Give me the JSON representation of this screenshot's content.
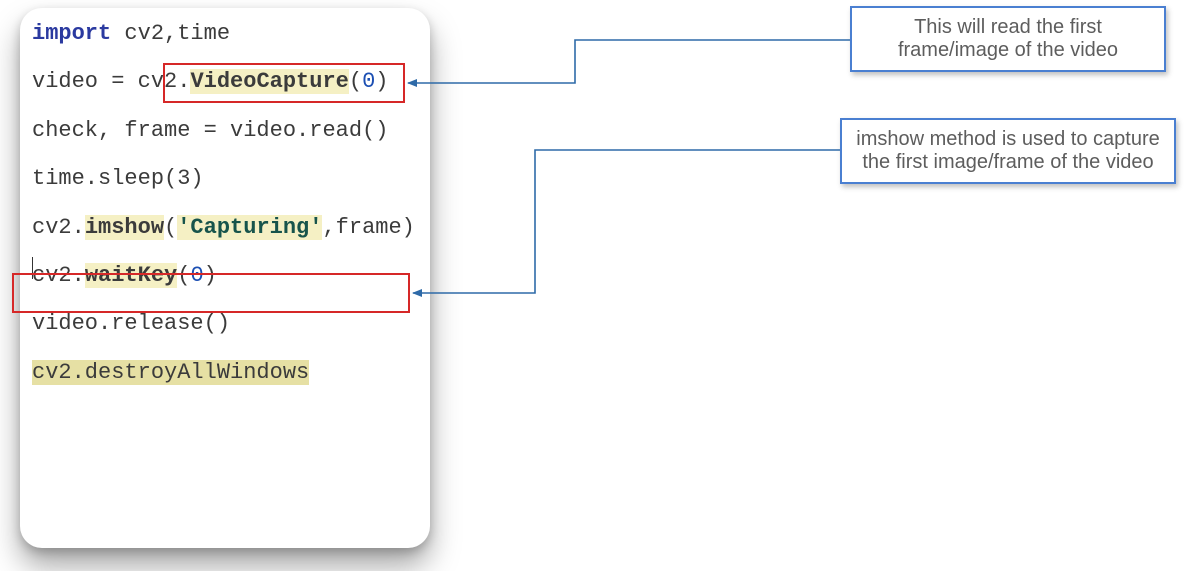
{
  "code": {
    "line1_import": "import",
    "line1_rest": " cv2,time",
    "blank": "",
    "line3_a": "video = cv2.",
    "line3_fn": "VideoCapture",
    "line3_paren_o": "(",
    "line3_num": "0",
    "line3_paren_c": ")",
    "line5": "check, frame = video.read()",
    "line7": "time.sleep(3)",
    "line9_a": "cv2.",
    "line9_fn": "imshow",
    "line9_paren_o": "(",
    "line9_str": "'Capturing'",
    "line9_rest": ",frame)",
    "line11_a": "cv2.",
    "line11_fn": "waitKey",
    "line11_paren_o": "(",
    "line11_num": "0",
    "line11_paren_c": ")",
    "line13": "video.release()",
    "line15": "cv2.destroyAllWindows"
  },
  "annotations": {
    "callout1_line1": "This will read the first",
    "callout1_line2": "frame/image of the video",
    "callout2_line1": "imshow method is used to capture",
    "callout2_line2": "the first image/frame of the video"
  }
}
